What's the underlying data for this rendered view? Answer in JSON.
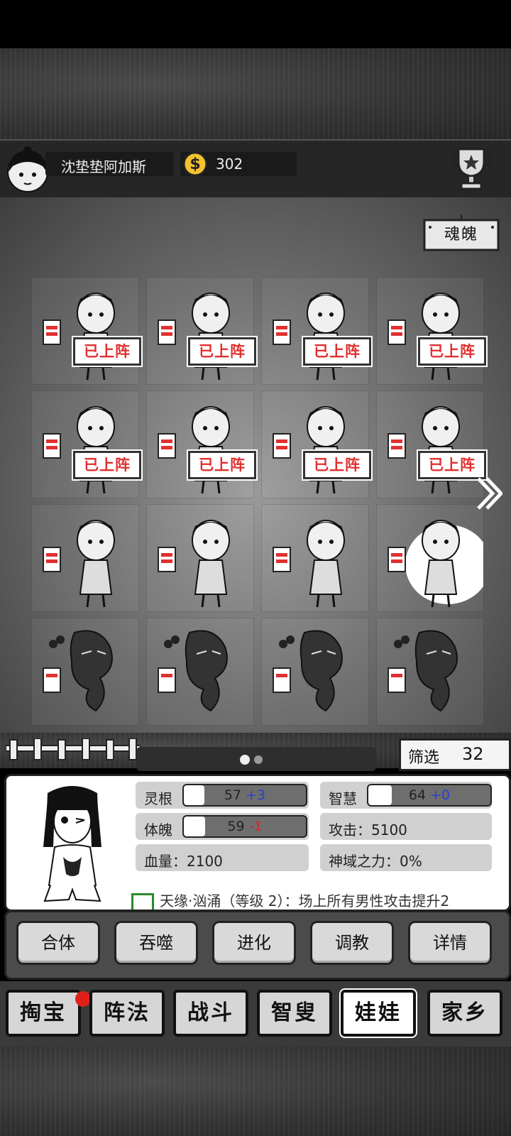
{
  "player": {
    "name": "沈垫垫阿加斯",
    "coins": "302"
  },
  "board": {
    "sign_label": "魂魄",
    "onfield_label": "已上阵",
    "cells": [
      {
        "onfield": true
      },
      {
        "onfield": true
      },
      {
        "onfield": true
      },
      {
        "onfield": true
      },
      {
        "onfield": true
      },
      {
        "onfield": true
      },
      {
        "onfield": true
      },
      {
        "onfield": true
      },
      {
        "onfield": false
      },
      {
        "onfield": false
      },
      {
        "onfield": false
      },
      {
        "onfield": false,
        "selected": true
      },
      {
        "onfield": false
      },
      {
        "onfield": false
      },
      {
        "onfield": false
      },
      {
        "onfield": false
      }
    ]
  },
  "pager": {
    "pages": 2,
    "current": 1
  },
  "filter": {
    "label": "筛选",
    "count": "32"
  },
  "selected": {
    "stats": {
      "root": {
        "label": "灵根",
        "value": "57",
        "delta": "+3",
        "fill": 0.57
      },
      "wisdom": {
        "label": "智慧",
        "value": "64",
        "delta": "+0",
        "fill": 0.64
      },
      "body": {
        "label": "体魄",
        "value": "59",
        "delta": "-1",
        "fill": 0.59
      },
      "attack": "攻击：5100",
      "hp": "血量：2100",
      "divine": "神域之力：0%"
    },
    "skill": "天缘·汹涌（等级 2）：场上所有男性攻击提升2"
  },
  "actions": [
    "合体",
    "吞噬",
    "进化",
    "调教",
    "详情"
  ],
  "nav": {
    "tabs": [
      "掏宝",
      "阵法",
      "战斗",
      "智叟",
      "娃娃",
      "家乡"
    ],
    "active_index": 4
  },
  "colors": {
    "onfield_text": "#e03030",
    "delta_plus": "#2a3fd0",
    "delta_minus": "#d02828",
    "notify": "#e0201a"
  }
}
